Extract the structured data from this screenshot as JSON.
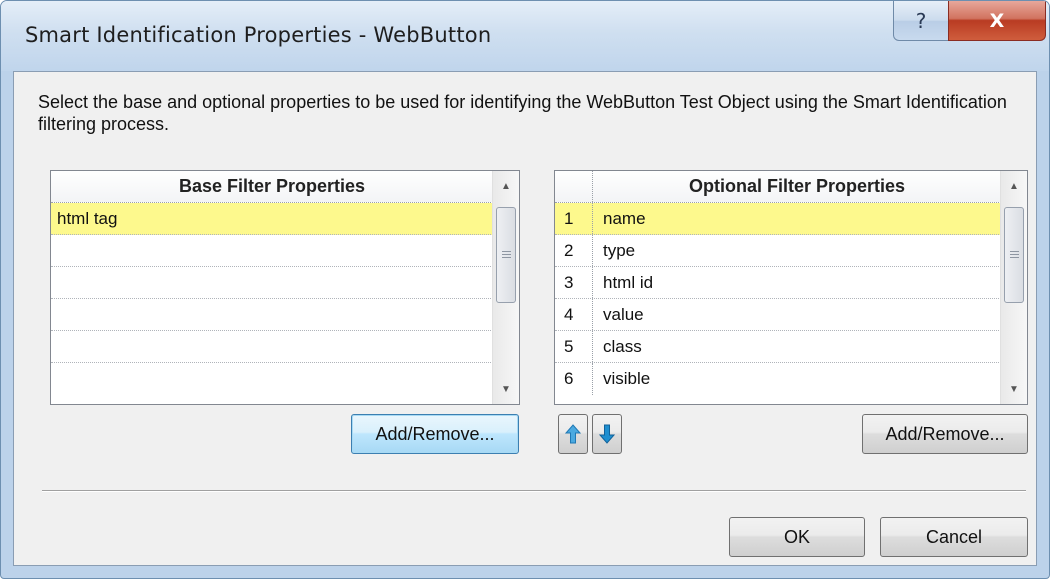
{
  "window": {
    "title": "Smart Identification Properties - WebButton",
    "help_label": "?",
    "close_label": "X"
  },
  "description": "Select the base and optional properties to be used for identifying the WebButton Test Object using the Smart Identification filtering process.",
  "base_filter": {
    "header": "Base Filter Properties",
    "rows": [
      "html tag",
      "",
      "",
      "",
      "",
      ""
    ],
    "selected_index": 0,
    "add_remove_label": "Add/Remove..."
  },
  "optional_filter": {
    "header": "Optional Filter Properties",
    "rows": [
      {
        "index": "1",
        "name": "name"
      },
      {
        "index": "2",
        "name": "type"
      },
      {
        "index": "3",
        "name": "html id"
      },
      {
        "index": "4",
        "name": "value"
      },
      {
        "index": "5",
        "name": "class"
      },
      {
        "index": "6",
        "name": "visible"
      }
    ],
    "selected_index": 0,
    "move_up_icon": "arrow-up-icon",
    "move_down_icon": "arrow-down-icon",
    "add_remove_label": "Add/Remove..."
  },
  "footer": {
    "ok_label": "OK",
    "cancel_label": "Cancel"
  },
  "colors": {
    "selection": "#fdf98d",
    "title_bar": "#c5d8ec",
    "close_button": "#c4452b",
    "arrow_icon": "#1f8fd0"
  }
}
